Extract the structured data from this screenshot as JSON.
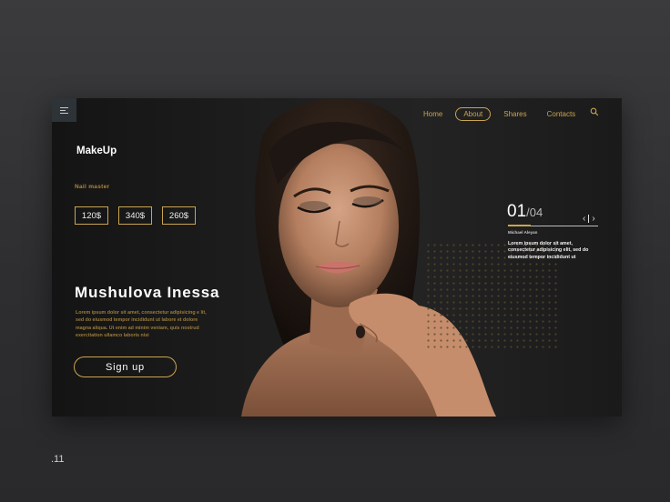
{
  "nav": {
    "items": [
      {
        "label": "Home",
        "active": false
      },
      {
        "label": "About",
        "active": true
      },
      {
        "label": "Shares",
        "active": false
      },
      {
        "label": "Contacts",
        "active": false
      }
    ]
  },
  "icons": {
    "menu": "hamburger-menu-icon",
    "search": "search-icon",
    "prev": "chevron-left-icon",
    "next": "chevron-right-icon"
  },
  "hero": {
    "brand": "MakeUp",
    "subtitle": "Nail master",
    "prices": [
      "120$",
      "340$",
      "260$"
    ],
    "name": "Mushulova Inessa",
    "description": "Lorem ipsum dolor sit amet, consectetur adipisicing e lit, sed do eiusmod tempor incididunt ut labore et dolore magna aliqua. Ut enim ad minim veniam, quis nostrud exercitation ullamco laboris nisi",
    "cta": "Sign up"
  },
  "slider": {
    "current": "01",
    "total": "/04",
    "progress": 0.25,
    "author": "Michael Aleyan",
    "text": "Lorem ipsum dolor sit amet, consectetur adipisicing elit, sed do eiusmod tempor incididunt ut"
  },
  "colors": {
    "accent": "#c9a451",
    "panel": "#1d1d1d",
    "background": "#333335"
  },
  "caption": ".11"
}
